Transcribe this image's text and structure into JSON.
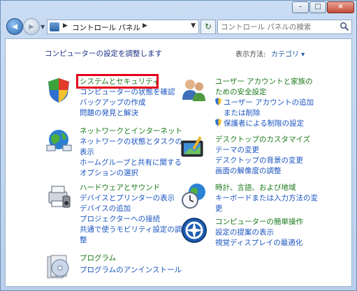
{
  "window": {
    "controls": {
      "minimize": "–",
      "maximize": "□",
      "close": "×"
    }
  },
  "navbar": {
    "back": "◀",
    "forward": "▶",
    "recent": "▼",
    "address_prefix_sep": "▶",
    "address_text": "コントロール パネル",
    "address_suffix_sep": "▶",
    "address_dropdown": "▼",
    "refresh": "↻",
    "search_placeholder": "コントロール パネルの検索"
  },
  "content": {
    "heading": "コンピューターの設定を調整します",
    "view_label": "表示方法:",
    "view_value": "カテゴリ ▾",
    "categories": [
      {
        "title": "システムとセキュリティ",
        "links": [
          "コンピューターの状態を確認",
          "バックアップの作成",
          "問題の発見と解決"
        ]
      },
      {
        "title": "ネットワークとインターネット",
        "links": [
          "ネットワークの状態とタスクの",
          "表示",
          "ホームグループと共有に関する",
          "オプションの選択"
        ]
      },
      {
        "title": "ハードウェアとサウンド",
        "links": [
          "デバイスとプリンターの表示",
          "デバイスの追加",
          "プロジェクターへの接続",
          "共通で使うモビリティ設定の調",
          "整"
        ]
      },
      {
        "title": "プログラム",
        "links": [
          "プログラムのアンインストール"
        ]
      },
      {
        "title_lines": [
          "ユーザー アカウントと家族の",
          "ための安全設定"
        ],
        "links": [
          "ユーザー アカウントの追加",
          "または削除",
          "保護者による制限の設定"
        ]
      },
      {
        "title": "デスクトップのカスタマイズ",
        "links": [
          "テーマの変更",
          "デスクトップの背景の変更",
          "画面の解像度の調整"
        ]
      },
      {
        "title": "時計、言語、および地域",
        "links": [
          "キーボードまたは入力方法の変",
          "更"
        ]
      },
      {
        "title": "コンピューターの簡単操作",
        "links": [
          "設定の提案の表示",
          "視覚ディスプレイの最適化"
        ]
      }
    ]
  },
  "colors": {
    "highlight": "#e3001b",
    "title_green": "#1b7a1b",
    "link_blue": "#1b55c2"
  },
  "icons": [
    "back-arrow-icon",
    "forward-arrow-icon",
    "control-panel-icon",
    "refresh-icon",
    "search-icon",
    "system-security-icon",
    "network-icon",
    "hardware-sound-icon",
    "programs-icon",
    "user-accounts-icon",
    "desktop-icon",
    "clock-region-icon",
    "ease-of-access-icon",
    "uac-shield-icon"
  ]
}
